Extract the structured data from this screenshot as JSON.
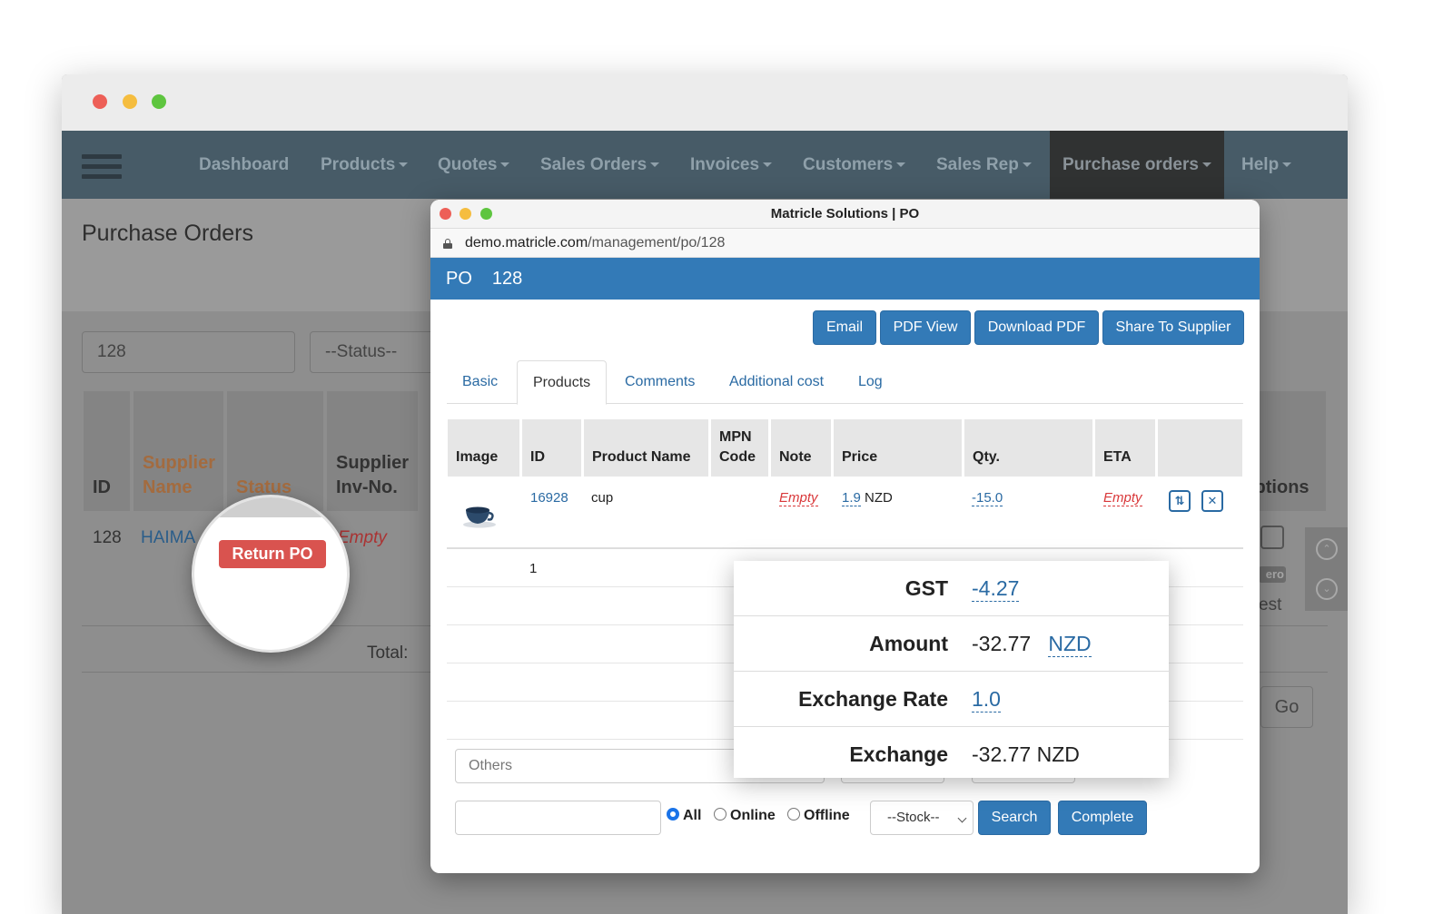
{
  "nav": {
    "items": [
      "Dashboard",
      "Products",
      "Quotes",
      "Sales Orders",
      "Invoices",
      "Customers",
      "Sales Rep",
      "Purchase orders",
      "Help"
    ]
  },
  "bg": {
    "page_title": "Purchase Orders",
    "search_value": "128",
    "status_placeholder": "--Status--",
    "headers": {
      "id": "ID",
      "supplier_name": "Supplier Name",
      "status": "Status",
      "supplier_inv": "Supplier Inv-No.",
      "options": "Options"
    },
    "row": {
      "id": "128",
      "supplier": "HAIMA",
      "inv": "Empty"
    },
    "total_label": "Total:",
    "go_label": "Go",
    "badge_partial": "ero",
    "est_partial": "est",
    "magnified_button": "Return PO"
  },
  "popup": {
    "window_title": "Matricle Solutions | PO",
    "url_host": "demo.matricle.com",
    "url_path": "/management/po/128",
    "po_label": "PO",
    "po_number": "128",
    "actions": [
      "Email",
      "PDF View",
      "Download PDF",
      "Share To Supplier"
    ],
    "tabs": [
      "Basic",
      "Products",
      "Comments",
      "Additional cost",
      "Log"
    ],
    "active_tab": "Products",
    "table": {
      "headers": [
        "Image",
        "ID",
        "Product Name",
        "MPN Code",
        "Note",
        "Price",
        "Qty.",
        "ETA"
      ],
      "rows": [
        {
          "id": "16928",
          "name": "cup",
          "note": "Empty",
          "price": "1.9",
          "currency": "NZD",
          "qty": "-15.0",
          "eta": "Empty"
        }
      ],
      "count": "1"
    },
    "others_placeholder": "Others",
    "radios": [
      "All",
      "Online",
      "Offline"
    ],
    "radio_selected": "All",
    "stock_select": "--Stock--",
    "search_button": "Search",
    "complete_button": "Complete"
  },
  "totals": {
    "gst_label": "GST",
    "gst_value": "-4.27",
    "amount_label": "Amount",
    "amount_value": "-32.77",
    "amount_currency": "NZD",
    "rate_label": "Exchange Rate",
    "rate_value": "1.0",
    "exchange_label": "Exchange",
    "exchange_value": "-32.77 NZD"
  },
  "colors": {
    "navbar": "#475b67",
    "primary": "#337ab7",
    "danger": "#d9534f",
    "empty_text": "#d9383a",
    "mac_red": "#ed5f57",
    "mac_yellow": "#f5bd3f",
    "mac_green": "#5ec53f"
  }
}
